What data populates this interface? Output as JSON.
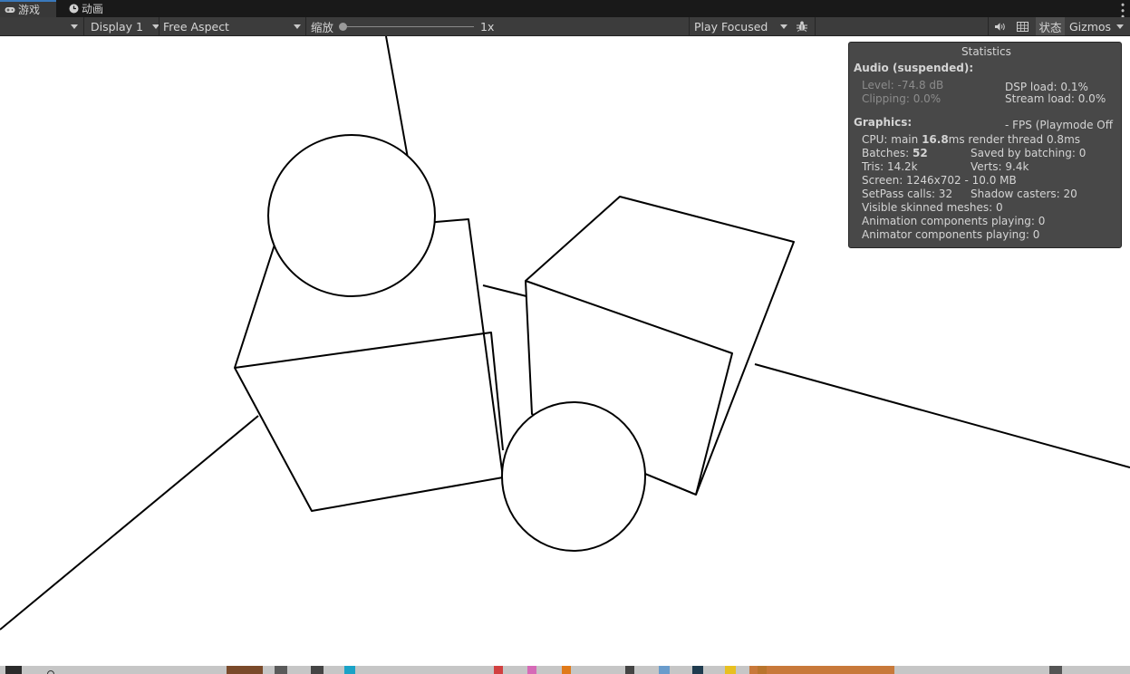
{
  "tabs": [
    {
      "label": "游戏",
      "icon": "gamepad-icon",
      "active": true
    },
    {
      "label": "动画",
      "icon": "clock-icon",
      "active": false
    }
  ],
  "toolbar": {
    "display": "Display 1",
    "aspect": "Free Aspect",
    "scale_label": "缩放",
    "scale_value": "1x",
    "play_mode": "Play Focused",
    "stats_button": "状态",
    "gizmos_button": "Gizmos",
    "icons": {
      "bug": "bug-icon",
      "audio": "speaker-icon",
      "grid": "grid-icon"
    }
  },
  "stats": {
    "title": "Statistics",
    "audio_header": "Audio (suspended):",
    "level": "Level: -74.8 dB",
    "clipping": "Clipping: 0.0%",
    "dsp_load": "DSP load: 0.1%",
    "stream_load": "Stream load: 0.0%",
    "graphics_header": "Graphics:",
    "fps": "- FPS (Playmode Off",
    "cpu_prefix": "CPU: main ",
    "cpu_main": "16.8",
    "cpu_suffix": "ms  render thread 0.8ms",
    "batches_prefix": "Batches: ",
    "batches": "52",
    "saved_batching": "Saved by batching: 0",
    "tris": "Tris: 14.2k",
    "verts": "Verts: 9.4k",
    "screen": "Screen: 1246x702 - 10.0 MB",
    "setpass": "SetPass calls: 32",
    "shadow_casters": "Shadow casters: 20",
    "skinned": "Visible skinned meshes: 0",
    "animation": "Animation components playing: 0",
    "animator": "Animator components playing: 0"
  },
  "colors": {
    "tab_bar": "#191919",
    "toolbar": "#3c3c3c",
    "accent": "#3a79bb",
    "scene_bg": "#ffffff",
    "stats_bg": "#3a3a3a"
  }
}
